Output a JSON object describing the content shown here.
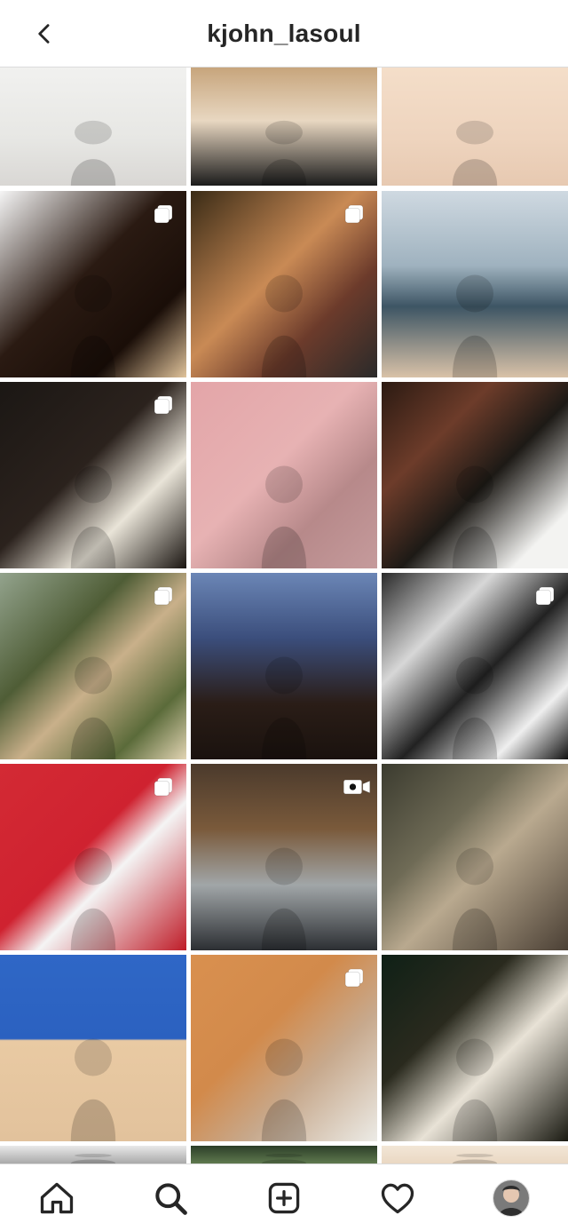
{
  "header": {
    "username": "kjohn_lasoul",
    "back_icon": "chevron-left-icon"
  },
  "grid": {
    "tiles": [
      {
        "id": "p1",
        "type": "photo",
        "bg": "linear-gradient(180deg,#f1f1ef 0%,#e7e7e4 60%,#d9d7d4 100%)"
      },
      {
        "id": "p2",
        "type": "photo",
        "bg": "linear-gradient(180deg,#c7a57c 0%,#e8d7c1 45%,#1b1b1b 100%)"
      },
      {
        "id": "p3",
        "type": "photo",
        "bg": "linear-gradient(180deg,#f4dec9 0%,#eed4be 60%,#e7c9b1 100%)"
      },
      {
        "id": "p4",
        "type": "carousel",
        "bg": "linear-gradient(135deg,#f5f5f5 0%,#2a1a12 45%,#1a0e08 75%,#e0c39b 100%)"
      },
      {
        "id": "p5",
        "type": "carousel",
        "bg": "linear-gradient(135deg,#3a2b16 0%,#c98a55 45%,#6c3b2b 70%,#2a2a2a 100%)"
      },
      {
        "id": "p6",
        "type": "photo",
        "bg": "linear-gradient(180deg,#cfd9e1 0%,#9fb2bf 40%,#3d5564 62%,#d9c2a8 100%)"
      },
      {
        "id": "p7",
        "type": "carousel",
        "bg": "linear-gradient(135deg,#1b1714 0%,#2b221d 45%,#e9e4d8 70%,#1a1511 100%)"
      },
      {
        "id": "p8",
        "type": "photo",
        "bg": "linear-gradient(135deg,#e3a5a8 0%,#e7b2b3 45%,#b7898a 70%,#c59b9c 100%)"
      },
      {
        "id": "p9",
        "type": "photo",
        "bg": "linear-gradient(135deg,#2b1a12 0%,#6d3c2a 30%,#1d1a16 55%,#f3f3f1 85%)"
      },
      {
        "id": "p10",
        "type": "carousel",
        "bg": "linear-gradient(135deg,#93a38d 0%,#4f5d36 35%,#c9b08a 55%,#5b6b3a 80%,#e2d4b3 100%)"
      },
      {
        "id": "p11",
        "type": "photo",
        "bg": "linear-gradient(180deg,#6b86b6 0%,#3b4e7c 35%,#2a1d17 70%,#1a120e 100%)"
      },
      {
        "id": "p12",
        "type": "carousel",
        "bg": "linear-gradient(135deg,#2a2a2a 0%,#d7d7d7 30%,#222 55%,#efefef 80%,#111 100%)"
      },
      {
        "id": "p13",
        "type": "carousel",
        "bg": "linear-gradient(135deg,#d32a34 0%,#cf2230 45%,#f4f4f4 60%,#bf1c28 100%)"
      },
      {
        "id": "p14",
        "type": "video",
        "bg": "linear-gradient(180deg,#4b3a2c 0%,#7a5a3b 35%,#a1a6a8 65%,#2c2f33 100%)"
      },
      {
        "id": "p15",
        "type": "photo",
        "bg": "linear-gradient(135deg,#3b3b2f 0%,#6f6b56 35%,#b9a98f 55%,#4b4035 100%)"
      },
      {
        "id": "p16",
        "type": "photo",
        "bg": "linear-gradient(180deg,#2f67c6 0%,#2b61c0 45%,#e9caa3 46%,#e2c29c 100%)"
      },
      {
        "id": "p17",
        "type": "carousel",
        "bg": "linear-gradient(135deg,#d9904f 0%,#d28a4b 40%,#c7a98d 65%,#ecebe6 100%)"
      },
      {
        "id": "p18",
        "type": "photo",
        "bg": "linear-gradient(135deg,#0f2016 0%,#2a2a1e 35%,#e8e2d6 60%,#1a1a12 100%)"
      },
      {
        "id": "p19",
        "type": "photo",
        "bg": "linear-gradient(180deg,#e9e9e9 0%,#a9a9a9 100%)"
      },
      {
        "id": "p20",
        "type": "photo",
        "bg": "linear-gradient(180deg,#2c3e28 0%,#5f7a4f 100%)"
      },
      {
        "id": "p21",
        "type": "photo",
        "bg": "linear-gradient(180deg,#f2e6d6 0%,#ead8c3 100%)"
      }
    ]
  },
  "tabbar": {
    "items": [
      {
        "id": "home",
        "icon": "home-icon"
      },
      {
        "id": "search",
        "icon": "search-icon"
      },
      {
        "id": "create",
        "icon": "plus-square-icon"
      },
      {
        "id": "activity",
        "icon": "heart-icon"
      },
      {
        "id": "profile",
        "icon": "avatar"
      }
    ]
  }
}
